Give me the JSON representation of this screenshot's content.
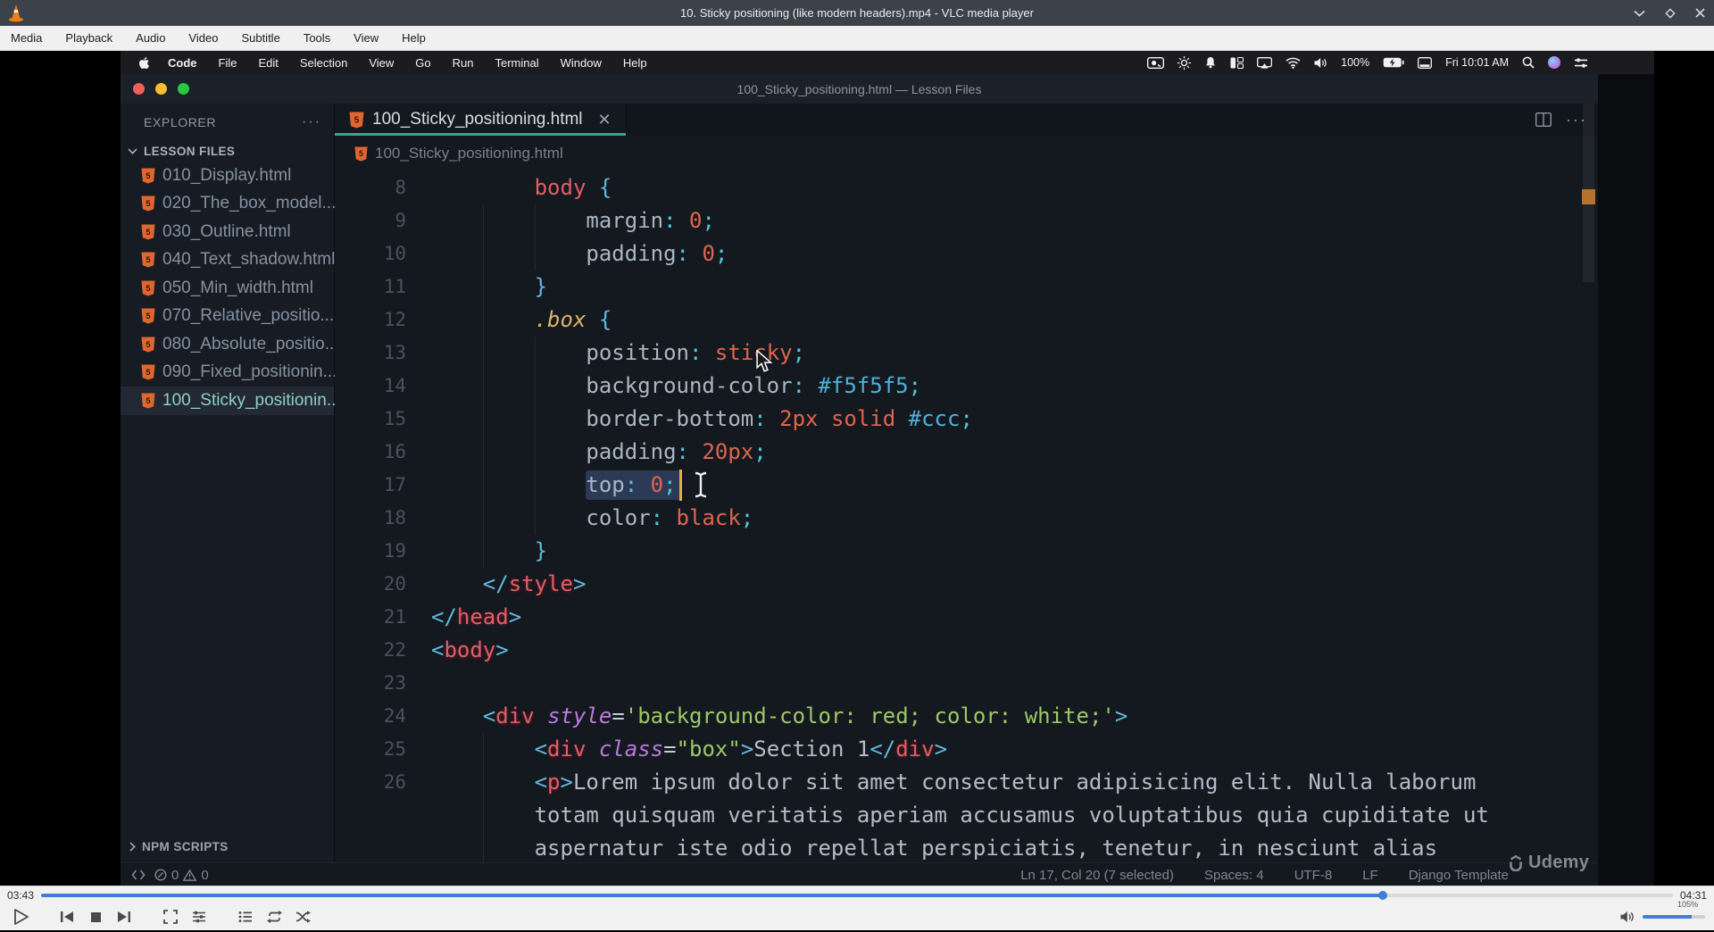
{
  "vlc": {
    "window_title": "10. Sticky positioning (like modern headers).mp4 - VLC media player",
    "menu": [
      "Media",
      "Playback",
      "Audio",
      "Video",
      "Subtitle",
      "Tools",
      "View",
      "Help"
    ],
    "time_current": "03:43",
    "time_total": "04:31",
    "progress_pct": 82.2,
    "volume_label": "105%",
    "volume_fill_pct": 78,
    "accent_blue": "#3f7fd8",
    "icons": [
      "play-icon",
      "previous-icon",
      "stop-icon",
      "next-icon",
      "fullscreen-icon",
      "extended-settings-icon",
      "playlist-icon",
      "loop-icon",
      "shuffle-icon",
      "speaker-icon",
      "minimize-icon",
      "maximize-icon",
      "close-icon",
      "vlc-cone-icon"
    ]
  },
  "mac": {
    "app_menu": [
      "Code",
      "File",
      "Edit",
      "Selection",
      "View",
      "Go",
      "Run",
      "Terminal",
      "Window",
      "Help"
    ],
    "clock": "Fri 10:01 AM",
    "battery_label": "100%",
    "icons": [
      "apple-icon",
      "screen-record-icon",
      "brightness-icon",
      "notification-icon",
      "tiles-icon",
      "display-mirror-icon",
      "wifi-icon",
      "volume-icon",
      "battery-charging-icon",
      "desktop-icon",
      "search-icon",
      "siri-icon",
      "control-center-icon"
    ]
  },
  "vscode": {
    "window_title": "100_Sticky_positioning.html — Lesson Files",
    "explorer": {
      "header": "EXPLORER",
      "header_menu": "···",
      "section": "LESSON FILES",
      "files": [
        {
          "label": "010_Display.html",
          "active": false
        },
        {
          "label": "020_The_box_model....",
          "active": false
        },
        {
          "label": "030_Outline.html",
          "active": false
        },
        {
          "label": "040_Text_shadow.html",
          "active": false
        },
        {
          "label": "050_Min_width.html",
          "active": false
        },
        {
          "label": "070_Relative_positio...",
          "active": false
        },
        {
          "label": "080_Absolute_positio...",
          "active": false
        },
        {
          "label": "090_Fixed_positionin...",
          "active": false
        },
        {
          "label": "100_Sticky_positionin...",
          "active": true
        }
      ],
      "npm_section": "NPM SCRIPTS"
    },
    "tab": {
      "label": "100_Sticky_positioning.html",
      "close": "✕"
    },
    "breadcrumb": "100_Sticky_positioning.html",
    "status": {
      "errors": "0",
      "warnings": "0",
      "items": [
        "Ln 17, Col 20 (7 selected)",
        "Spaces: 4",
        "UTF-8",
        "LF",
        "Django Template"
      ]
    },
    "code": {
      "lines": [
        {
          "n": "8",
          "seg": [
            [
              "        "
            ],
            [
              "body",
              "sel"
            ],
            [
              " "
            ],
            [
              "{",
              "brace"
            ]
          ]
        },
        {
          "n": "9",
          "seg": [
            [
              "            "
            ],
            [
              "margin",
              "prop"
            ],
            [
              ":",
              "pun"
            ],
            [
              " "
            ],
            [
              "0",
              "val"
            ],
            [
              ";",
              "pun"
            ]
          ]
        },
        {
          "n": "10",
          "seg": [
            [
              "            "
            ],
            [
              "padding",
              "prop"
            ],
            [
              ":",
              "pun"
            ],
            [
              " "
            ],
            [
              "0",
              "val"
            ],
            [
              ";",
              "pun"
            ]
          ]
        },
        {
          "n": "11",
          "seg": [
            [
              "        "
            ],
            [
              "}",
              "brace"
            ]
          ]
        },
        {
          "n": "12",
          "seg": [
            [
              "        "
            ],
            [
              ".box",
              "cls"
            ],
            [
              " "
            ],
            [
              "{",
              "brace"
            ]
          ]
        },
        {
          "n": "13",
          "seg": [
            [
              "            "
            ],
            [
              "position",
              "prop"
            ],
            [
              ":",
              "pun"
            ],
            [
              " "
            ],
            [
              "sticky",
              "val"
            ],
            [
              ";",
              "pun"
            ]
          ]
        },
        {
          "n": "14",
          "seg": [
            [
              "            "
            ],
            [
              "background-color",
              "prop"
            ],
            [
              ":",
              "pun"
            ],
            [
              " "
            ],
            [
              "#f5f5f5",
              "hex"
            ],
            [
              ";",
              "pun"
            ]
          ]
        },
        {
          "n": "15",
          "seg": [
            [
              "            "
            ],
            [
              "border-bottom",
              "prop"
            ],
            [
              ":",
              "pun"
            ],
            [
              " "
            ],
            [
              "2px",
              "val"
            ],
            [
              " "
            ],
            [
              "solid",
              "val"
            ],
            [
              " "
            ],
            [
              "#ccc",
              "hex"
            ],
            [
              ";",
              "pun"
            ]
          ]
        },
        {
          "n": "16",
          "seg": [
            [
              "            "
            ],
            [
              "padding",
              "prop"
            ],
            [
              ":",
              "pun"
            ],
            [
              " "
            ],
            [
              "20px",
              "val"
            ],
            [
              ";",
              "pun"
            ]
          ]
        },
        {
          "n": "17",
          "seg": [
            [
              "            "
            ],
            [
              "top",
              "prop"
            ],
            [
              ":",
              "pun"
            ],
            [
              " "
            ],
            [
              "0",
              "val"
            ],
            [
              ";",
              "pun"
            ]
          ],
          "selection": true,
          "caret": true
        },
        {
          "n": "18",
          "seg": [
            [
              "            "
            ],
            [
              "color",
              "prop"
            ],
            [
              ":",
              "pun"
            ],
            [
              " "
            ],
            [
              "black",
              "val"
            ],
            [
              ";",
              "pun"
            ]
          ]
        },
        {
          "n": "19",
          "seg": [
            [
              "        "
            ],
            [
              "}",
              "brace"
            ]
          ]
        },
        {
          "n": "20",
          "seg": [
            [
              "    "
            ],
            [
              "</",
              "ang"
            ],
            [
              "style",
              "tag"
            ],
            [
              ">",
              "ang"
            ]
          ]
        },
        {
          "n": "21",
          "seg": [
            [
              "</",
              "ang"
            ],
            [
              "head",
              "tag"
            ],
            [
              ">",
              "ang"
            ]
          ]
        },
        {
          "n": "22",
          "seg": [
            [
              "<",
              "ang"
            ],
            [
              "body",
              "tag"
            ],
            [
              ">",
              "ang"
            ]
          ]
        },
        {
          "n": "23",
          "seg": []
        },
        {
          "n": "24",
          "seg": [
            [
              "    "
            ],
            [
              "<",
              "ang"
            ],
            [
              "div",
              "tag"
            ],
            [
              " "
            ],
            [
              "style",
              "attr"
            ],
            [
              "=",
              "eq"
            ],
            [
              "'background-color: red; color: white;'",
              "str"
            ],
            [
              ">",
              "ang"
            ]
          ]
        },
        {
          "n": "25",
          "seg": [
            [
              "        "
            ],
            [
              "<",
              "ang"
            ],
            [
              "div",
              "tag"
            ],
            [
              " "
            ],
            [
              "class",
              "attr"
            ],
            [
              "=",
              "eq"
            ],
            [
              "\"box\"",
              "str"
            ],
            [
              ">",
              "ang"
            ],
            [
              "Section 1",
              "txt"
            ],
            [
              "</",
              "ang"
            ],
            [
              "div",
              "tag"
            ],
            [
              ">",
              "ang"
            ]
          ]
        },
        {
          "n": "26",
          "seg": [
            [
              "        "
            ],
            [
              "<",
              "ang"
            ],
            [
              "p",
              "tag"
            ],
            [
              ">",
              "ang"
            ],
            [
              "Lorem ipsum dolor sit amet consectetur adipisicing elit. Nulla laborum",
              "txt"
            ]
          ]
        },
        {
          "n": "",
          "seg": [
            [
              "        "
            ],
            [
              "totam quisquam veritatis aperiam accusamus voluptatibus quia cupiditate ut",
              "txt"
            ]
          ]
        },
        {
          "n": "",
          "seg": [
            [
              "        "
            ],
            [
              "aspernatur iste odio repellat perspiciatis, tenetur, in nesciunt alias",
              "txt"
            ]
          ]
        }
      ]
    }
  },
  "watermark": {
    "label": "Udemy"
  }
}
